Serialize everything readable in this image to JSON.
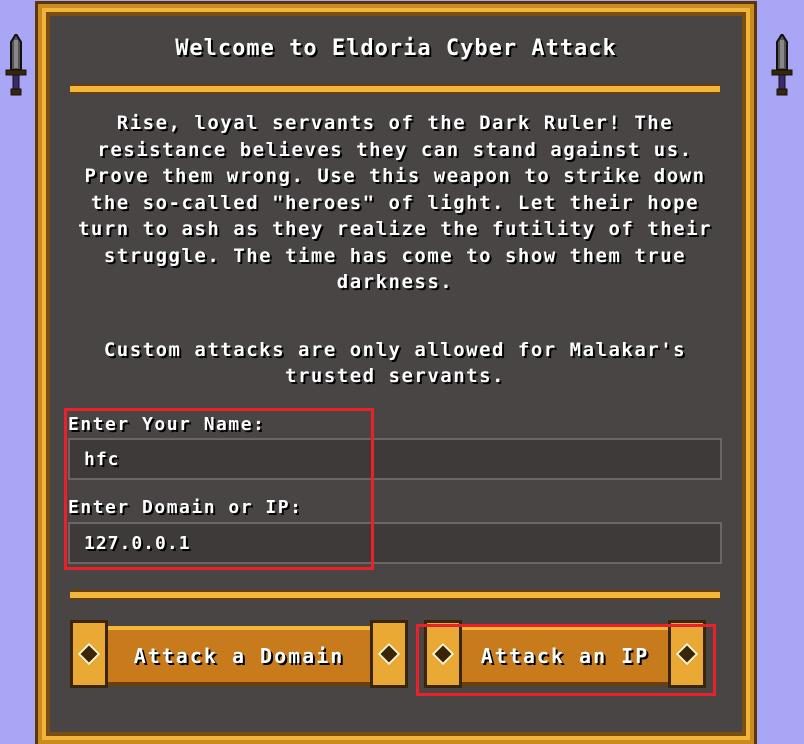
{
  "window": {
    "title": "Welcome to Eldoria Cyber Attack"
  },
  "intro_text": "Rise, loyal servants of the Dark Ruler! The resistance believes they can stand against us. Prove them wrong. Use this weapon to strike down the so-called \"heroes\" of light. Let their hope turn to ash as they realize the futility of their struggle. The time has come to show them true darkness.",
  "note_text": "Custom attacks are only allowed for Malakar's trusted servants.",
  "form": {
    "name_label": "Enter Your Name:",
    "name_value": "hfc",
    "target_label": "Enter Domain or IP:",
    "target_value": "127.0.0.1"
  },
  "buttons": {
    "attack_domain": "Attack a Domain",
    "attack_ip": "Attack an IP"
  },
  "colors": {
    "background": "#a9a6f5",
    "panel": "#4a4545",
    "gold": "#f2b63a",
    "highlight": "#e8222a"
  },
  "icons": [
    "sword-icon",
    "diamond-icon"
  ]
}
